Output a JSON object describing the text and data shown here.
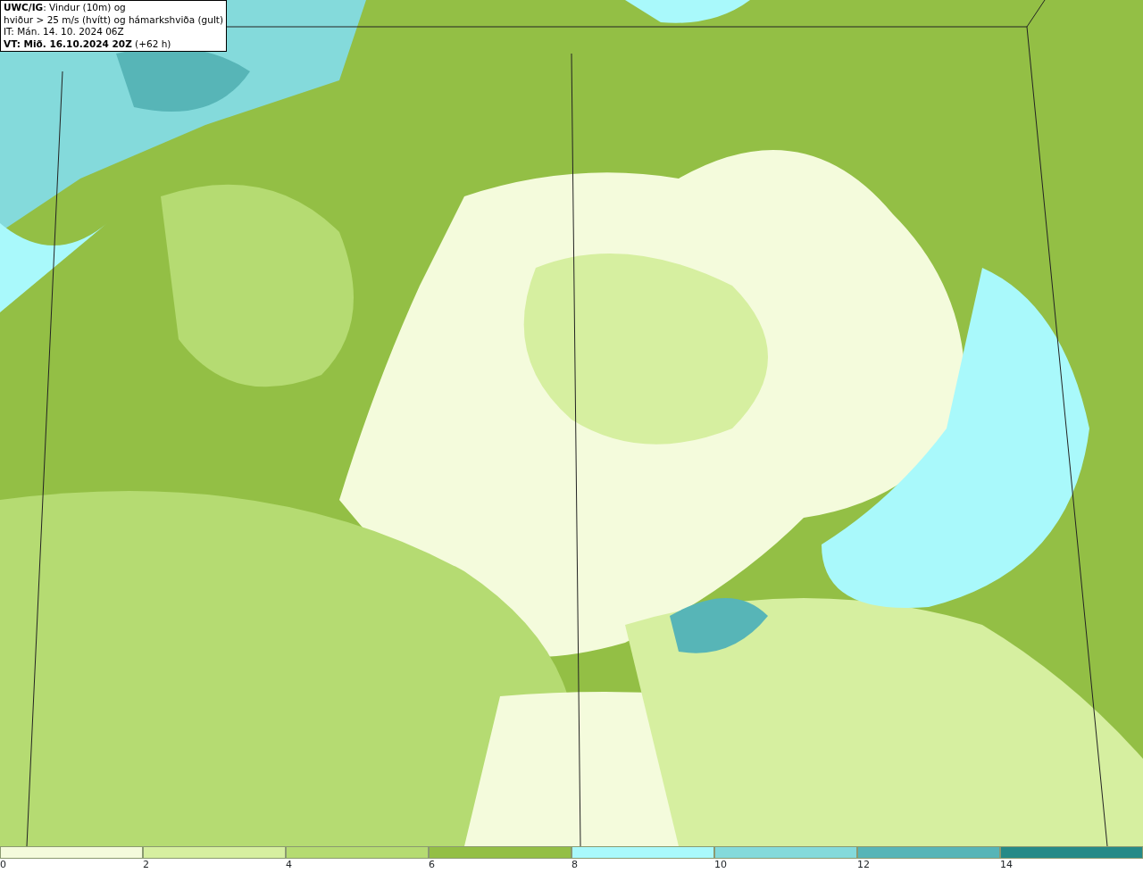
{
  "info_box": {
    "lines": [
      "**UWC/IG**: Vindur (10m) og",
      "hviður > 25 m/s (hvítt) og hámarkshviða (gult)",
      "IT: Mán. 14. 10. 2024 06Z",
      "**VT: Mið. 16.10.2024 20Z** (+62 h)"
    ]
  },
  "legend": [
    {
      "label": "0",
      "color": "#f4fbdc"
    },
    {
      "label": "2",
      "color": "#d6efa0"
    },
    {
      "label": "4",
      "color": "#b5db72"
    },
    {
      "label": "6",
      "color": "#93bf45"
    },
    {
      "label": "8",
      "color": "#a9f9fb"
    },
    {
      "label": "10",
      "color": "#84dadb"
    },
    {
      "label": "12",
      "color": "#57b5b7"
    },
    {
      "label": "14",
      "color": "#258a87"
    }
  ]
}
